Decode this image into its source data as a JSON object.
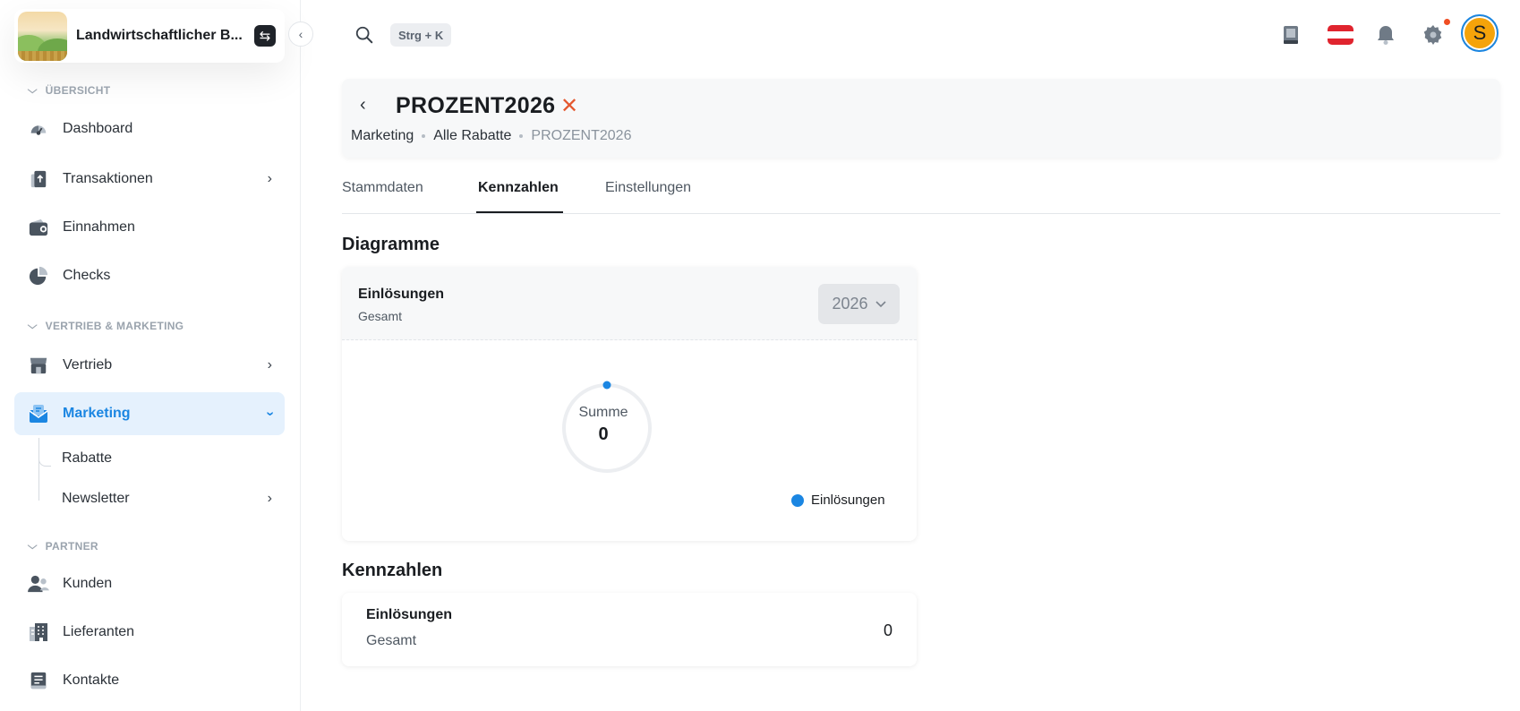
{
  "brand": {
    "name": "Landwirtschaftlicher B..."
  },
  "search": {
    "shortcut": "Strg + K"
  },
  "user": {
    "initial": "S"
  },
  "colors": {
    "accent": "#1b86e2",
    "active_bg": "#e5f1fd",
    "close_red": "#e4582f",
    "avatar_bg": "#f5a30a",
    "notification": "#f04e23"
  },
  "sidebar": {
    "sections": [
      {
        "label": "ÜBERSICHT"
      },
      {
        "label": "VERTRIEB & MARKETING"
      },
      {
        "label": "PARTNER"
      }
    ],
    "items": [
      {
        "label": "Dashboard",
        "icon": "gauge-icon"
      },
      {
        "label": "Transaktionen",
        "icon": "transactions-icon"
      },
      {
        "label": "Einnahmen",
        "icon": "wallet-icon"
      },
      {
        "label": "Checks",
        "icon": "pie-chart-icon"
      },
      {
        "label": "Vertrieb",
        "icon": "store-icon"
      },
      {
        "label": "Marketing",
        "icon": "mail-icon"
      },
      {
        "label": "Kunden",
        "icon": "users-icon"
      },
      {
        "label": "Lieferanten",
        "icon": "building-icon"
      },
      {
        "label": "Kontakte",
        "icon": "address-book-icon"
      }
    ],
    "subitems": [
      {
        "label": "Rabatte"
      },
      {
        "label": "Newsletter"
      }
    ]
  },
  "header": {
    "title": "PROZENT2026",
    "breadcrumb": [
      "Marketing",
      "Alle Rabatte",
      "PROZENT2026"
    ]
  },
  "tabs": [
    {
      "label": "Stammdaten"
    },
    {
      "label": "Kennzahlen",
      "active": true
    },
    {
      "label": "Einstellungen"
    }
  ],
  "charts_section": {
    "heading": "Diagramme",
    "card": {
      "title": "Einlösungen",
      "subtitle": "Gesamt",
      "year": "2026",
      "center_label": "Summe",
      "center_value": "0",
      "legend": "Einlösungen",
      "legend_color": "#1b86e2"
    }
  },
  "chart_data": {
    "type": "pie",
    "title": "Einlösungen",
    "subtitle": "Gesamt",
    "categories": [
      "Einlösungen"
    ],
    "values": [
      0
    ],
    "total_label": "Summe",
    "total": 0,
    "legend_placement": "bottom-right"
  },
  "kpi_section": {
    "heading": "Kennzahlen",
    "card": {
      "title": "Einlösungen",
      "subtitle": "Gesamt",
      "value": "0"
    }
  }
}
